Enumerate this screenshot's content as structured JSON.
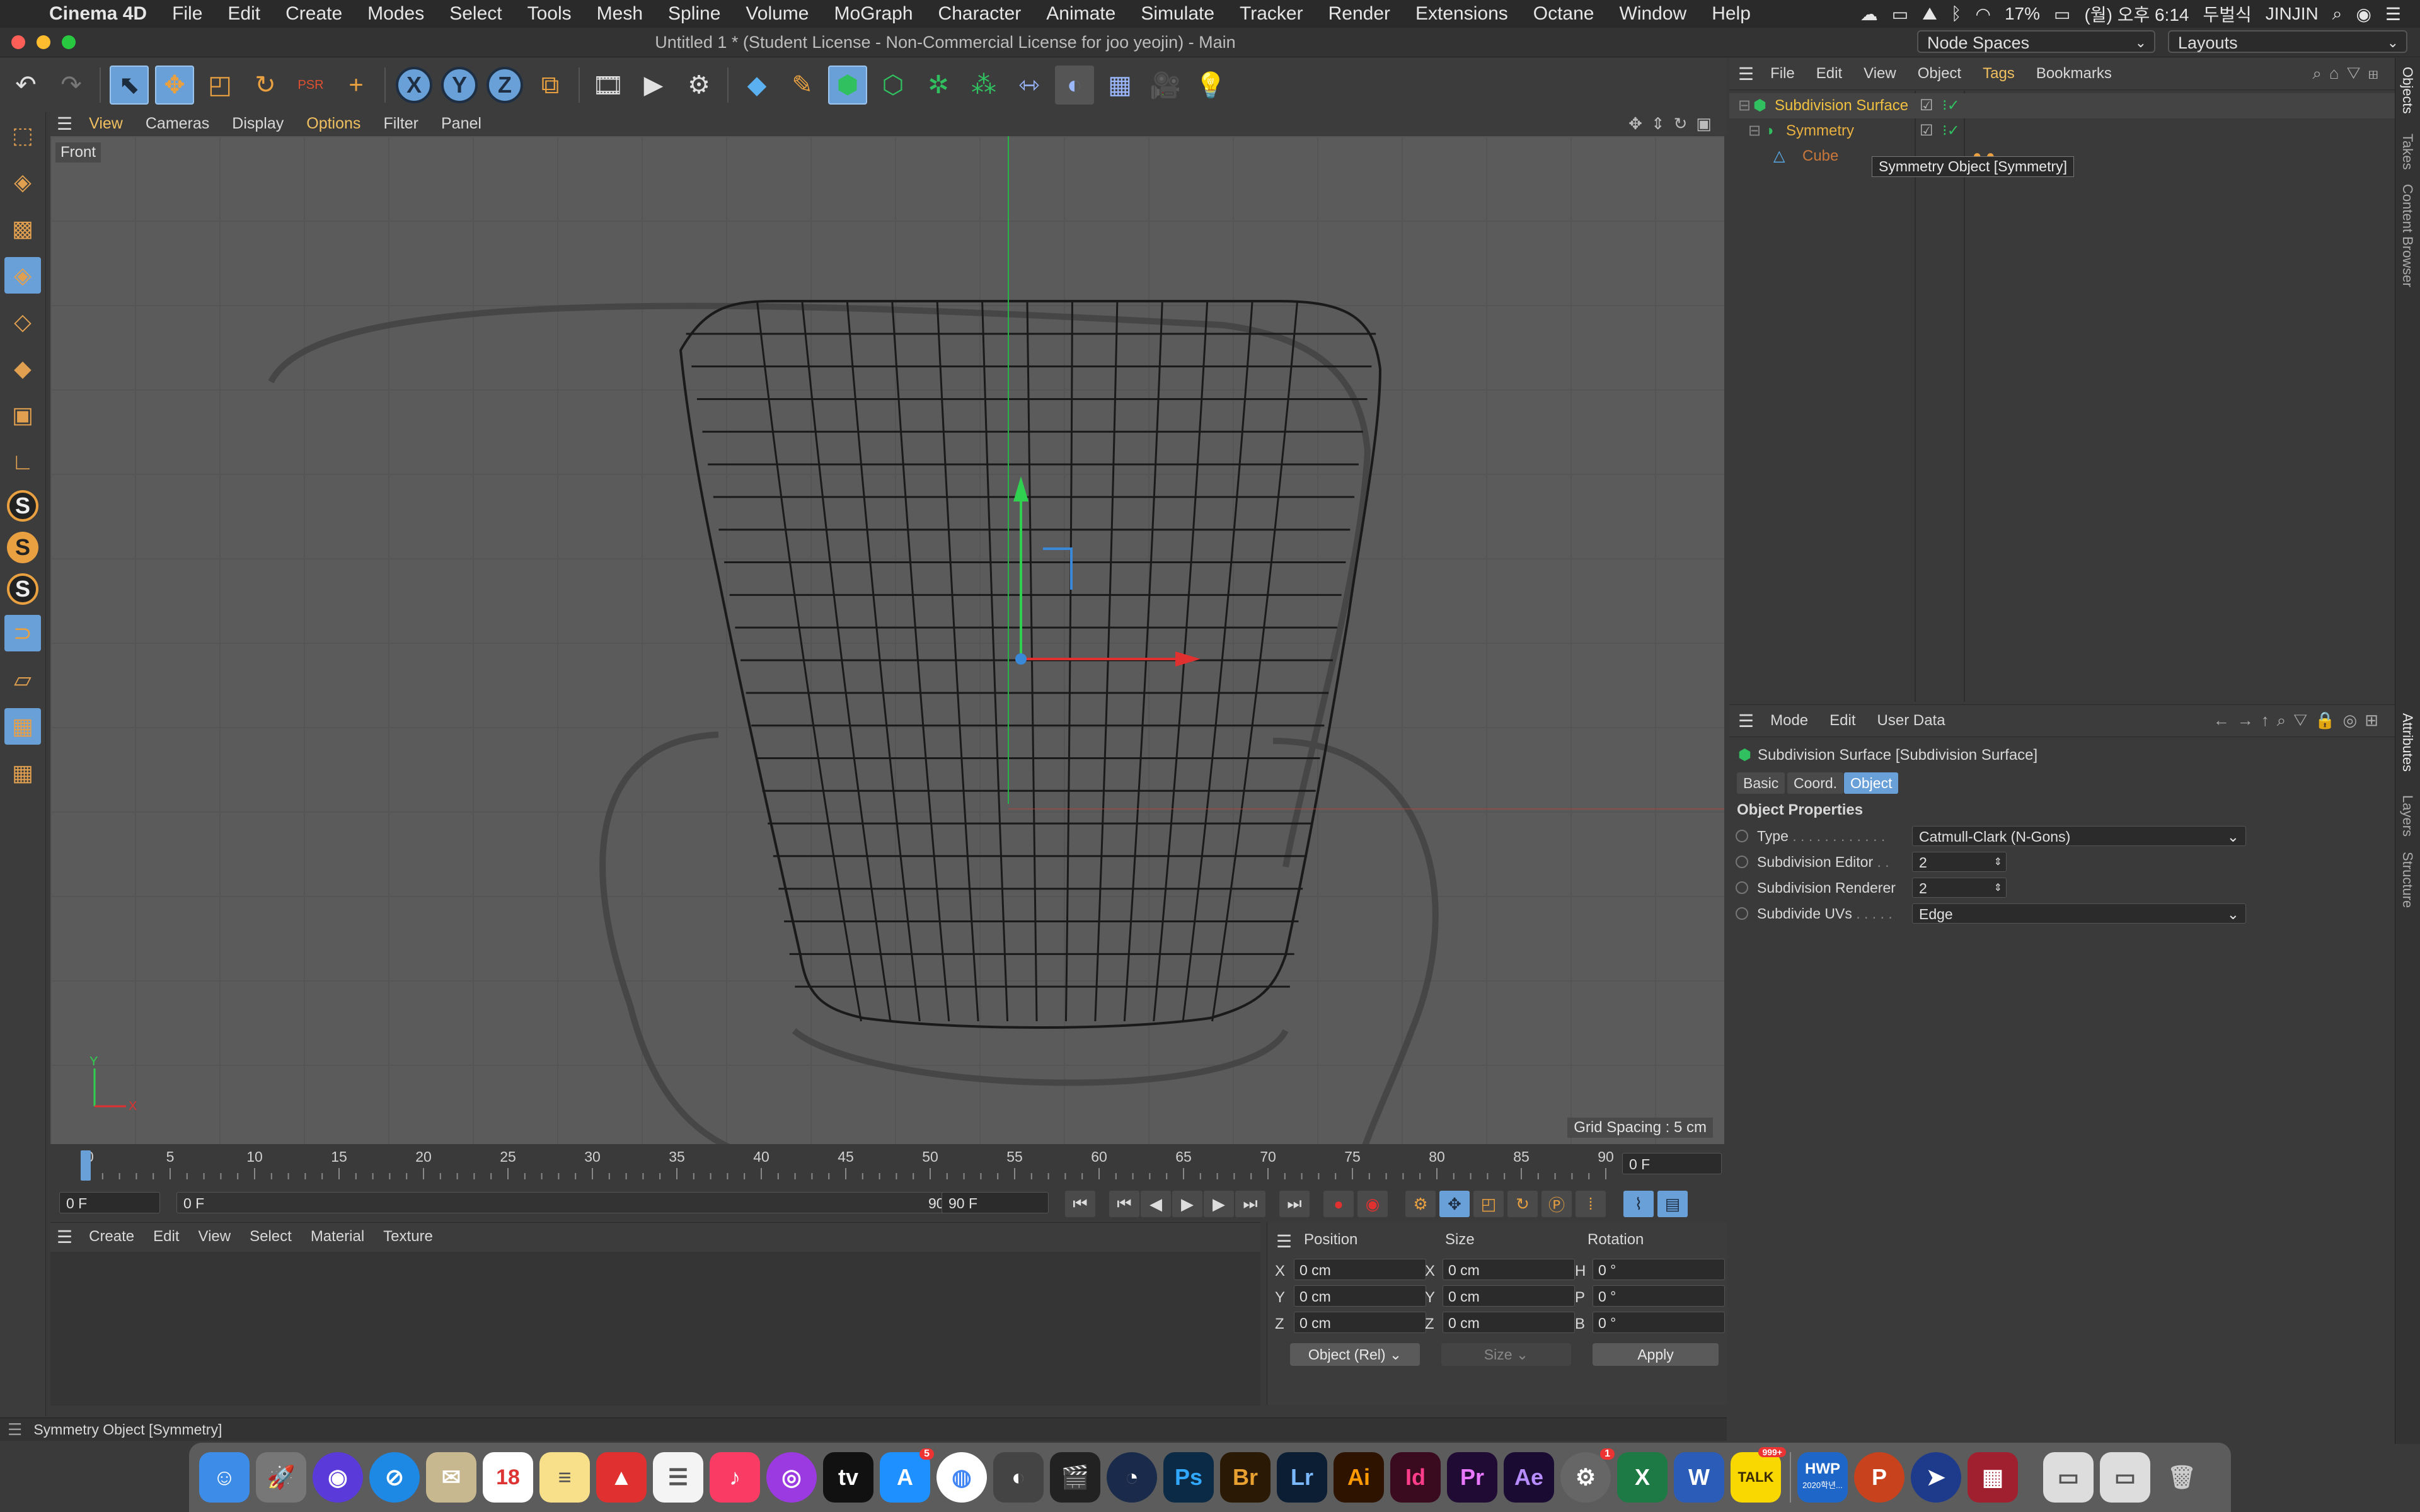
{
  "menubar": {
    "apple": "",
    "app_name": "Cinema 4D",
    "items": [
      "File",
      "Edit",
      "Create",
      "Modes",
      "Select",
      "Tools",
      "Mesh",
      "Spline",
      "Volume",
      "MoGraph",
      "Character",
      "Animate",
      "Simulate",
      "Tracker",
      "Render",
      "Extensions",
      "Octane",
      "Window",
      "Help"
    ],
    "battery": "17%",
    "clock": "(월) 오후 6:14",
    "input_method": "두벌식",
    "user": "JINJIN"
  },
  "titlebar": {
    "title": "Untitled 1 * (Student License - Non-Commercial License for joo yeojin) - Main",
    "node_spaces": "Node Spaces",
    "layouts": "Layouts"
  },
  "toolbar": {
    "psr_label": "PSR",
    "axis_x": "X",
    "axis_y": "Y",
    "axis_z": "Z"
  },
  "viewport_menu": {
    "items": [
      "View",
      "Cameras",
      "Display",
      "Options",
      "Filter",
      "Panel"
    ]
  },
  "viewport": {
    "view_name": "Front",
    "grid_spacing": "Grid Spacing : 5 cm",
    "axis_y": "Y",
    "axis_x": "X"
  },
  "timeline": {
    "ticks": [
      "0",
      "5",
      "10",
      "15",
      "20",
      "25",
      "30",
      "35",
      "40",
      "45",
      "50",
      "55",
      "60",
      "65",
      "70",
      "75",
      "80",
      "85",
      "90"
    ],
    "current_frame": "0 F",
    "start_frame": "0 F",
    "range_start": "0 F",
    "range_end": "90 F",
    "end_frame": "90 F"
  },
  "material_manager": {
    "menu": [
      "Create",
      "Edit",
      "View",
      "Select",
      "Material",
      "Texture"
    ]
  },
  "coordinates": {
    "headers": {
      "position": "Position",
      "size": "Size",
      "rotation": "Rotation"
    },
    "rows": [
      {
        "pos_label": "X",
        "pos": "0 cm",
        "size_label": "X",
        "size": "0 cm",
        "rot_label": "H",
        "rot": "0 °"
      },
      {
        "pos_label": "Y",
        "pos": "0 cm",
        "size_label": "Y",
        "size": "0 cm",
        "rot_label": "P",
        "rot": "0 °"
      },
      {
        "pos_label": "Z",
        "pos": "0 cm",
        "size_label": "Z",
        "size": "0 cm",
        "rot_label": "B",
        "rot": "0 °"
      }
    ],
    "mode": "Object (Rel)",
    "size_mode": "Size",
    "apply": "Apply"
  },
  "status": {
    "text": "Symmetry Object [Symmetry]"
  },
  "object_manager": {
    "menu": [
      "File",
      "Edit",
      "View",
      "Object",
      "Tags",
      "Bookmarks"
    ],
    "objects": [
      {
        "name": "Subdivision Surface",
        "color": "#f0c040"
      },
      {
        "name": "Symmetry",
        "color": "#e8b040"
      },
      {
        "name": "Cube",
        "color": "#c8783a"
      }
    ],
    "tooltip": "Symmetry Object [Symmetry]"
  },
  "attribute_manager": {
    "menu": [
      "Mode",
      "Edit",
      "User Data"
    ],
    "object_title": "Subdivision Surface [Subdivision Surface]",
    "tabs": [
      "Basic",
      "Coord.",
      "Object"
    ],
    "section": "Object Properties",
    "properties": [
      {
        "label": "Type",
        "dots": " . . . . . . . . . . . .",
        "value": "Catmull-Clark (N-Gons)"
      },
      {
        "label": "Subdivision Editor",
        "dots": " . .",
        "value": "2"
      },
      {
        "label": "Subdivision Renderer",
        "dots": "",
        "value": "2"
      },
      {
        "label": "Subdivide UVs",
        "dots": " . . . . .",
        "value": "Edge"
      }
    ]
  },
  "side_tabs": [
    "Objects",
    "Takes",
    "Content Browser",
    "Attributes",
    "Layers",
    "Structure"
  ],
  "dock": {
    "calendar_day": "18",
    "appstore_badge": "5",
    "prefs_badge": "1",
    "talk_badge": "999+",
    "talk": "TALK",
    "hwp": "HWP",
    "hwp_sub": "2020학년...",
    "apps": [
      {
        "label": "Ps",
        "color": "#0b2a45",
        "fg": "#31a8ff"
      },
      {
        "label": "Br",
        "color": "#2a1a05",
        "fg": "#e8a030"
      },
      {
        "label": "Lr",
        "color": "#0b1e33",
        "fg": "#7ab8ff"
      },
      {
        "label": "Ai",
        "color": "#2e1400",
        "fg": "#ff9a00"
      },
      {
        "label": "Id",
        "color": "#3a0a1f",
        "fg": "#ff3d8b"
      },
      {
        "label": "Pr",
        "color": "#1f0b33",
        "fg": "#ea77ff"
      },
      {
        "label": "Ae",
        "color": "#1a0b33",
        "fg": "#b78cff"
      }
    ]
  }
}
